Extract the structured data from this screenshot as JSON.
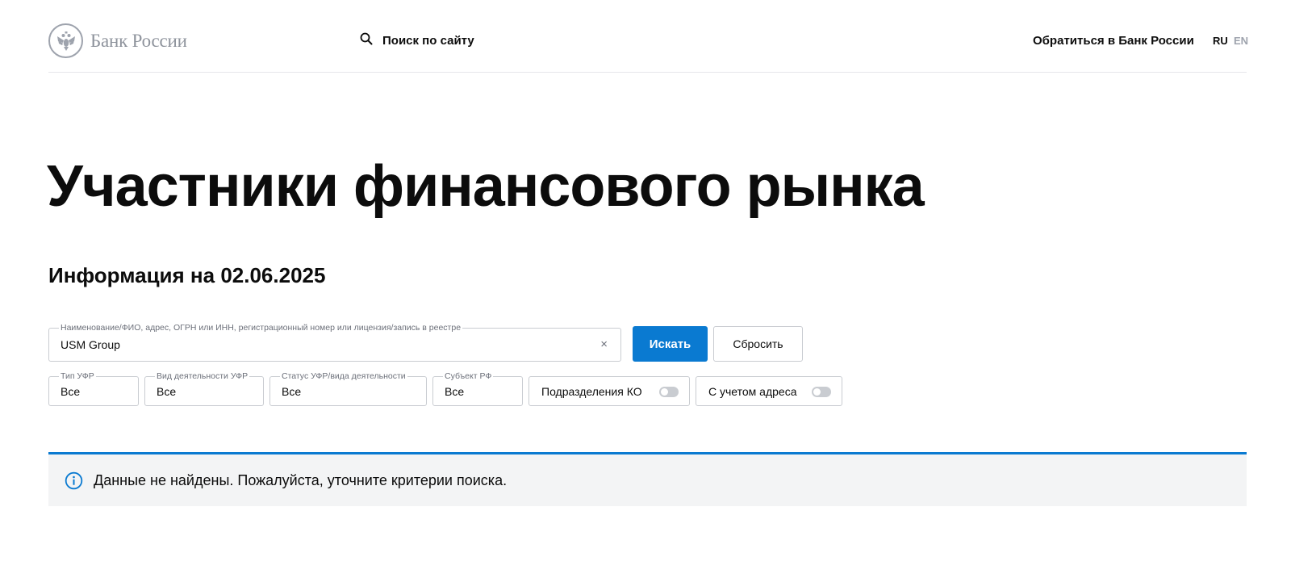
{
  "header": {
    "logo_text": "Банк России",
    "search_label": "Поиск по сайту",
    "contact_label": "Обратиться в Банк России",
    "lang_ru": "RU",
    "lang_en": "EN"
  },
  "page": {
    "title": "Участники финансового рынка",
    "info_date": "Информация на 02.06.2025"
  },
  "search_form": {
    "main_input_legend": "Наименование/ФИО, адрес, ОГРН или ИНН, регистрационный номер или лицензия/запись в реестре",
    "main_input_value": "USM Group",
    "clear_icon": "×",
    "search_button": "Искать",
    "reset_button": "Сбросить",
    "filters": [
      {
        "legend": "Тип УФР",
        "value": "Все"
      },
      {
        "legend": "Вид деятельности УФР",
        "value": "Все"
      },
      {
        "legend": "Статус УФР/вида деятельности",
        "value": "Все"
      },
      {
        "legend": "Субъект РФ",
        "value": "Все"
      }
    ],
    "toggles": [
      {
        "label": "Подразделения КО",
        "on": false
      },
      {
        "label": "С учетом адреса",
        "on": false
      }
    ]
  },
  "notice": {
    "text": "Данные не найдены. Пожалуйста, уточните критерии поиска."
  },
  "colors": {
    "accent": "#0a7ad1",
    "border": "#c9ccd1",
    "notice_bg": "#f3f4f5",
    "logo_gray": "#8e939c"
  },
  "icons": {
    "logo": "double-headed-eagle-emblem-icon",
    "search": "magnifier-icon",
    "clear": "close-icon",
    "notice": "info-circle-icon"
  }
}
